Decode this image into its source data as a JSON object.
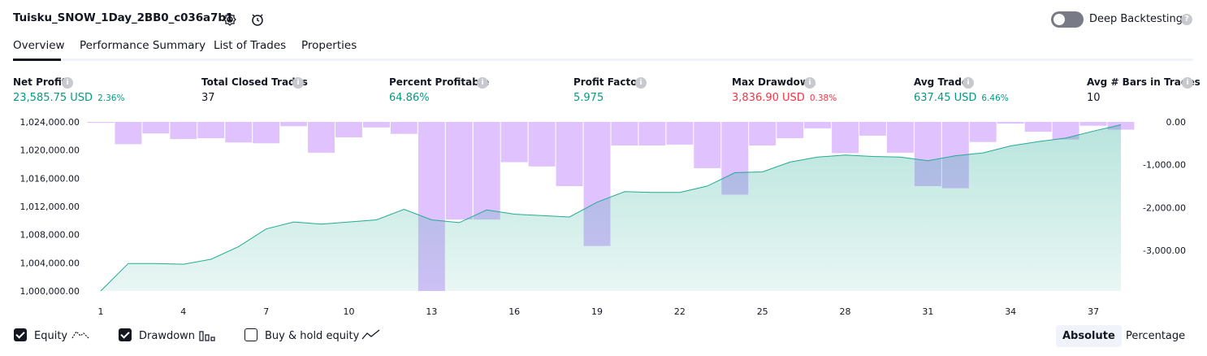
{
  "header": {
    "title": "Tuisku_SNOW_1Day_2BB0_c036a7b1",
    "deep_backtesting_label": "Deep Backtesting",
    "deep_backtesting_enabled": false
  },
  "tabs": [
    {
      "label": "Overview",
      "active": true
    },
    {
      "label": "Performance Summary",
      "active": false
    },
    {
      "label": "List of Trades",
      "active": false
    },
    {
      "label": "Properties",
      "active": false
    }
  ],
  "metrics": [
    {
      "label": "Net Profit",
      "value": "23,585.75 USD",
      "pct": "2.36%",
      "color": "#089981"
    },
    {
      "label": "Total Closed Trades",
      "value": "37",
      "pct": "",
      "color": "#131722"
    },
    {
      "label": "Percent Profitable",
      "value": "64.86%",
      "pct": "",
      "color": "#089981"
    },
    {
      "label": "Profit Factor",
      "value": "5.975",
      "pct": "",
      "color": "#089981"
    },
    {
      "label": "Max Drawdown",
      "value": "3,836.90 USD",
      "pct": "0.38%",
      "color": "#f23645"
    },
    {
      "label": "Avg Trade",
      "value": "637.45 USD",
      "pct": "6.46%",
      "color": "#089981"
    },
    {
      "label": "Avg # Bars in Trades",
      "value": "10",
      "pct": "",
      "color": "#131722"
    }
  ],
  "chart_data": {
    "type": "area",
    "x_ticks": [
      "1",
      "4",
      "7",
      "10",
      "13",
      "16",
      "19",
      "22",
      "25",
      "28",
      "31",
      "34",
      "37"
    ],
    "y_left_ticks": [
      "1,024,000.00",
      "1,020,000.00",
      "1,016,000.00",
      "1,012,000.00",
      "1,008,000.00",
      "1,004,000.00",
      "1,000,000.00"
    ],
    "y_right_ticks": [
      "0.00",
      "-1,000.00",
      "-2,000.00",
      "-3,000.00"
    ],
    "ylim_left": [
      1000000,
      1024000
    ],
    "ylim_right": [
      -3950,
      0
    ],
    "series": [
      {
        "name": "Equity",
        "type": "area",
        "color": "#22ab94",
        "values": [
          1000000,
          1003900,
          1003900,
          1003800,
          1004500,
          1006300,
          1008800,
          1009800,
          1009500,
          1009800,
          1010100,
          1011600,
          1010100,
          1009700,
          1011500,
          1010900,
          1010700,
          1010500,
          1012600,
          1014100,
          1014000,
          1014000,
          1014900,
          1016800,
          1016900,
          1018300,
          1019000,
          1019300,
          1019100,
          1019000,
          1018500,
          1019200,
          1019600,
          1020600,
          1021200,
          1021700,
          1022700,
          1023600
        ]
      },
      {
        "name": "Drawdown",
        "type": "bar",
        "color": "#cc99ff",
        "values": [
          -20,
          -520,
          -270,
          -400,
          -380,
          -480,
          -500,
          -100,
          -720,
          -360,
          -130,
          -280,
          -3950,
          -2280,
          -2280,
          -940,
          -1040,
          -1500,
          -2900,
          -550,
          -550,
          -530,
          -1080,
          -1700,
          -550,
          -380,
          -150,
          -730,
          -320,
          -720,
          -1500,
          -1550,
          -470,
          -40,
          -230,
          -410,
          -90,
          -180
        ]
      }
    ]
  },
  "legend": {
    "equity": {
      "label": "Equity",
      "checked": true
    },
    "drawdown": {
      "label": "Drawdown",
      "checked": true
    },
    "buyhold": {
      "label": "Buy & hold equity",
      "checked": false
    }
  },
  "view_toggle": {
    "absolute_label": "Absolute",
    "percentage_label": "Percentage",
    "selected": "Absolute"
  }
}
